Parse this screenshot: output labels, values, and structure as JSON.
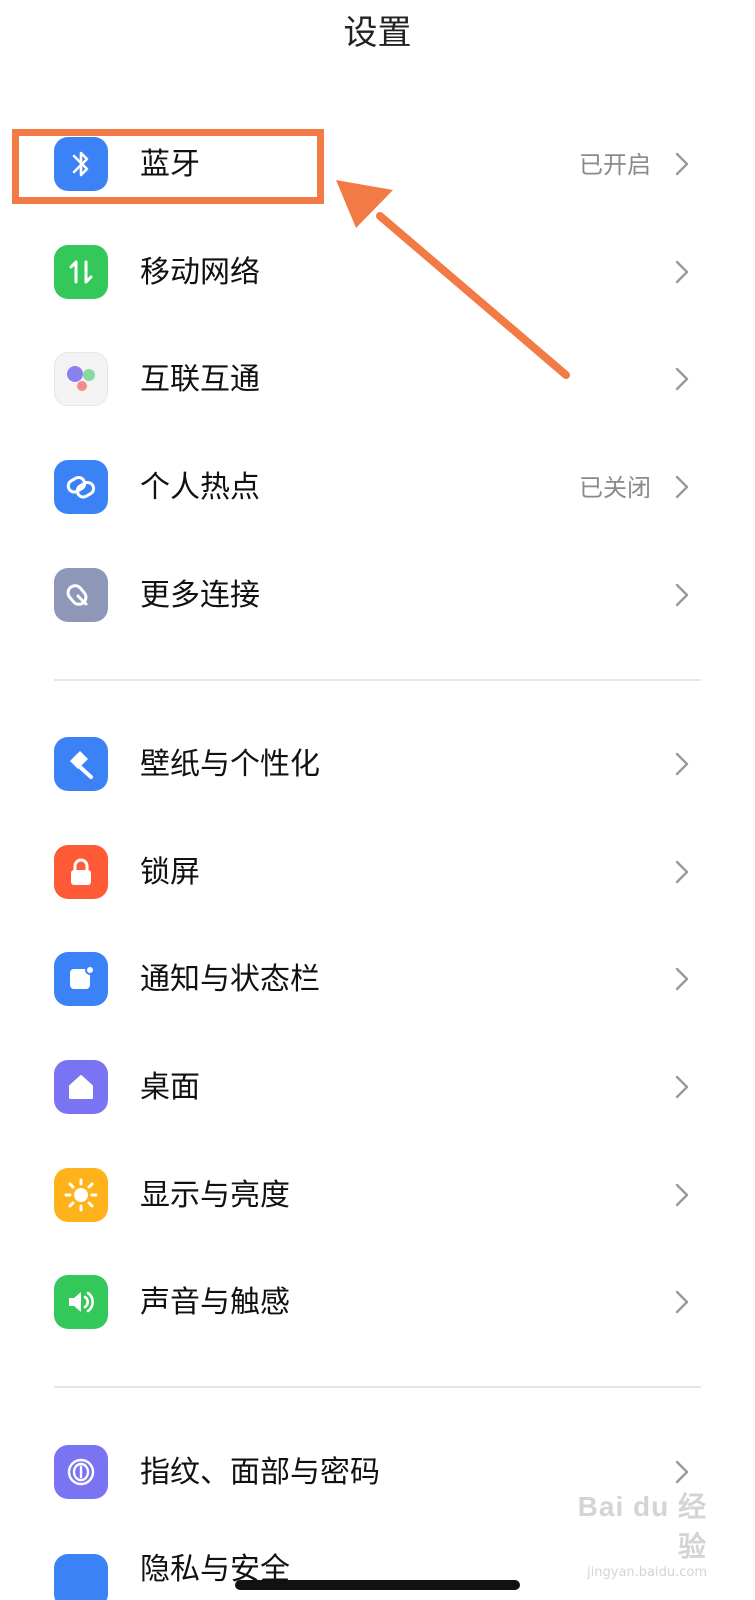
{
  "header": {
    "title": "设置"
  },
  "groups": [
    {
      "items": [
        {
          "label": "蓝牙",
          "status": "已开启",
          "icon": "bluetooth-icon",
          "color": "#3b82f6"
        },
        {
          "label": "移动网络",
          "status": "",
          "icon": "mobile-data-icon",
          "color": "#34c759"
        },
        {
          "label": "互联互通",
          "status": "",
          "icon": "interconnect-icon",
          "color": "#f2f2f2"
        },
        {
          "label": "个人热点",
          "status": "已关闭",
          "icon": "hotspot-link-icon",
          "color": "#3b82f6"
        },
        {
          "label": "更多连接",
          "status": "",
          "icon": "more-connections-icon",
          "color": "#8e97b8"
        }
      ]
    },
    {
      "items": [
        {
          "label": "壁纸与个性化",
          "status": "",
          "icon": "wallpaper-brush-icon",
          "color": "#3b82f6"
        },
        {
          "label": "锁屏",
          "status": "",
          "icon": "lock-icon",
          "color": "#ff5a36"
        },
        {
          "label": "通知与状态栏",
          "status": "",
          "icon": "notification-icon",
          "color": "#3b82f6"
        },
        {
          "label": "桌面",
          "status": "",
          "icon": "home-icon",
          "color": "#7b74f2"
        },
        {
          "label": "显示与亮度",
          "status": "",
          "icon": "brightness-sun-icon",
          "color": "#ffb21a"
        },
        {
          "label": "声音与触感",
          "status": "",
          "icon": "speaker-icon",
          "color": "#34c759"
        }
      ]
    },
    {
      "items": [
        {
          "label": "指纹、面部与密码",
          "status": "",
          "icon": "fingerprint-icon",
          "color": "#7b74f2"
        }
      ]
    }
  ],
  "partial_item": {
    "label": "隐私与安全",
    "icon": "privacy-icon",
    "color": "#3b82f6"
  },
  "annotation": {
    "highlight_color": "#f27a45"
  },
  "watermark": {
    "brand": "Bai du 经验",
    "url": "jingyan.baidu.com"
  }
}
